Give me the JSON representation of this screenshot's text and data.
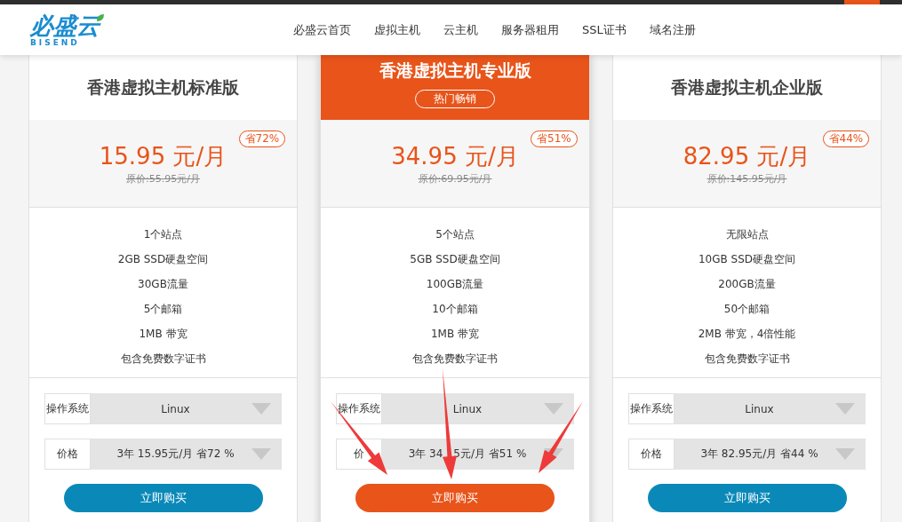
{
  "logo": {
    "name": "必盛云",
    "sub": "BISEND"
  },
  "nav": [
    {
      "label": "必盛云首页"
    },
    {
      "label": "虚拟主机"
    },
    {
      "label": "云主机"
    },
    {
      "label": "服务器租用"
    },
    {
      "label": "SSL证书"
    },
    {
      "label": "域名注册"
    }
  ],
  "plans": [
    {
      "title": "香港虚拟主机标准版",
      "featured": false,
      "price": "15.95 元/月",
      "discount": "省72%",
      "original": "原价:55.95元/月",
      "features": [
        "1个站点",
        "2GB SSD硬盘空间",
        "30GB流量",
        "5个邮箱",
        "1MB 带宽",
        "包含免费数字证书"
      ],
      "os_label": "操作系统",
      "os": "Linux",
      "price_label": "价格",
      "price_option": [
        "3年 15.95元/月 省72 %"
      ],
      "buy": "立即购买"
    },
    {
      "title": "香港虚拟主机专业版",
      "featured": true,
      "badge": "热门畅销",
      "price": "34.95 元/月",
      "discount": "省51%",
      "original": "原价:69.95元/月",
      "features": [
        "5个站点",
        "5GB SSD硬盘空间",
        "100GB流量",
        "10个邮箱",
        "1MB 带宽",
        "包含免费数字证书"
      ],
      "os_label": "操作系统",
      "os": "Linux",
      "price_label": "价",
      "price_option": [
        "3年 34",
        "5元/月 省51 %"
      ],
      "buy": "立即购买"
    },
    {
      "title": "香港虚拟主机企业版",
      "featured": false,
      "price": "82.95 元/月",
      "discount": "省44%",
      "original": "原价:145.95元/月",
      "features": [
        "无限站点",
        "10GB SSD硬盘空间",
        "200GB流量",
        "50个邮箱",
        "2MB 带宽，4倍性能",
        "包含免费数字证书"
      ],
      "os_label": "操作系统",
      "os": "Linux",
      "price_label": "价格",
      "price_option": [
        "3年 82.95元/月 省44 %"
      ],
      "buy": "立即购买"
    }
  ]
}
